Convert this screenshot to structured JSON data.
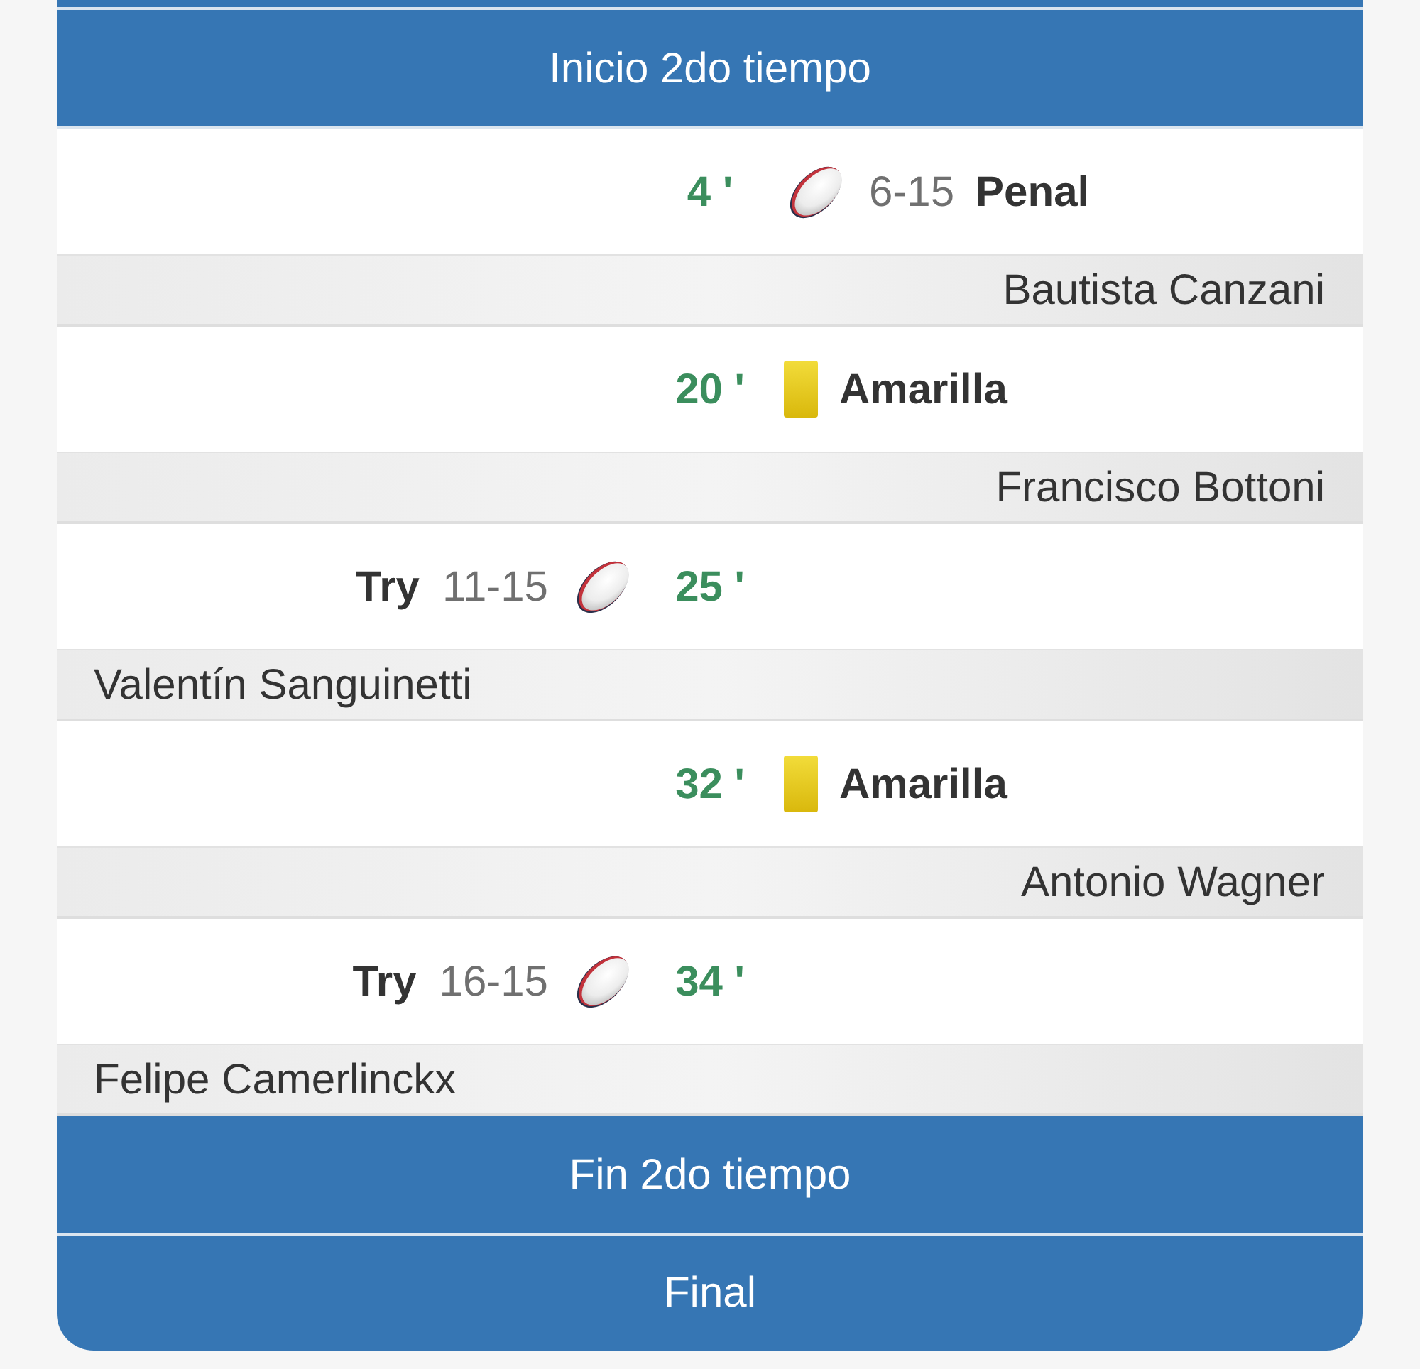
{
  "timeline": [
    {
      "kind": "header",
      "title": "Inicio 2do tiempo"
    },
    {
      "kind": "score",
      "minute": "4 '",
      "right": {
        "score": "6-15",
        "label": "Penal"
      },
      "player": "Bautista Canzani"
    },
    {
      "kind": "card",
      "minute": "20 '",
      "right": {
        "label": "Amarilla"
      },
      "player": "Francisco Bottoni"
    },
    {
      "kind": "score",
      "minute": "25 '",
      "left": {
        "label": "Try",
        "score": "11-15"
      },
      "player": "Valentín Sanguinetti"
    },
    {
      "kind": "card",
      "minute": "32 '",
      "right": {
        "label": "Amarilla"
      },
      "player": "Antonio Wagner"
    },
    {
      "kind": "score",
      "minute": "34 '",
      "left": {
        "label": "Try",
        "score": "16-15"
      },
      "player": "Felipe Camerlinckx"
    },
    {
      "kind": "header",
      "title": "Fin 2do tiempo"
    },
    {
      "kind": "header",
      "title": "Final"
    }
  ]
}
